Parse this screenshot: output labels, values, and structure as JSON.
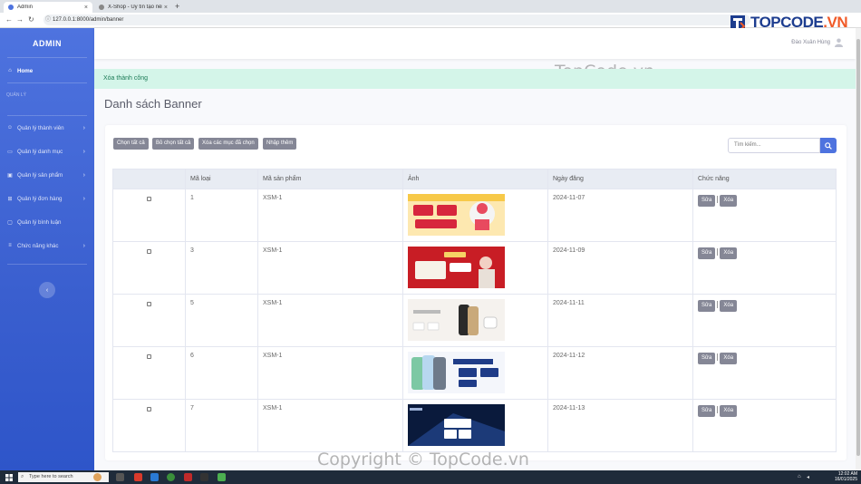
{
  "browser": {
    "tabs": [
      {
        "label": "Admin",
        "active": true
      },
      {
        "label": "X-Shop - Uy tín tạo nên thươn...",
        "active": false
      }
    ],
    "url": "127.0.0.1:8000/admin/banner"
  },
  "sidebar": {
    "brand": "ADMIN",
    "home": "Home",
    "heading": "QUẢN LÝ",
    "items": [
      {
        "label": "Quản lý thành viên",
        "icon": "user-icon",
        "has_children": true
      },
      {
        "label": "Quản lý danh mục",
        "icon": "folder-icon",
        "has_children": true
      },
      {
        "label": "Quản lý sản phẩm",
        "icon": "box-icon",
        "has_children": true
      },
      {
        "label": "Quản lý đơn hàng",
        "icon": "cart-icon",
        "has_children": true
      },
      {
        "label": "Quản lý bình luận",
        "icon": "comment-icon",
        "has_children": false
      },
      {
        "label": "Chức năng khác",
        "icon": "list-icon",
        "has_children": true
      }
    ],
    "toggle": "‹"
  },
  "topbar": {
    "username": "Đào Xuân Hùng"
  },
  "alert": {
    "message": "Xóa thành công"
  },
  "page_title": "Danh sách Banner",
  "toolbar": {
    "select_all": "Chọn tất cả",
    "deselect_all": "Bỏ chọn tất cả",
    "delete_selected": "Xóa các mục đã chọn",
    "add_new": "Nhập thêm",
    "search_placeholder": "Tìm kiếm..."
  },
  "table": {
    "headers": [
      "",
      "Mã loại",
      "Mã sản phẩm",
      "Ảnh",
      "Ngày đăng",
      "Chức năng"
    ],
    "edit_label": "Sửa",
    "delete_label": "Xóa",
    "rows": [
      {
        "id": "1",
        "product": "XSM-1",
        "date": "2024-11-07",
        "banner": "banner-red-yellow-promo"
      },
      {
        "id": "3",
        "product": "XSM-1",
        "date": "2024-11-09",
        "banner": "banner-reno-red"
      },
      {
        "id": "5",
        "product": "XSM-1",
        "date": "2024-11-11",
        "banner": "banner-iphone-light"
      },
      {
        "id": "6",
        "product": "XSM-1",
        "date": "2024-11-12",
        "banner": "banner-redmi-note-14"
      },
      {
        "id": "7",
        "product": "XSM-1",
        "date": "2024-11-13",
        "banner": "banner-samsung-dark"
      }
    ]
  },
  "watermark": {
    "logo_text_1": "TOPCODE",
    "logo_text_2": ".VN",
    "mid": "TopCode.vn",
    "bottom": "Copyright © TopCode.vn"
  },
  "taskbar": {
    "search_placeholder": "Type here to search",
    "time": "12:02 AM",
    "date": "16/01/2025"
  },
  "colors": {
    "primary": "#4e73df",
    "secondary_button": "#858796",
    "alert_bg": "#d4f5e9"
  }
}
